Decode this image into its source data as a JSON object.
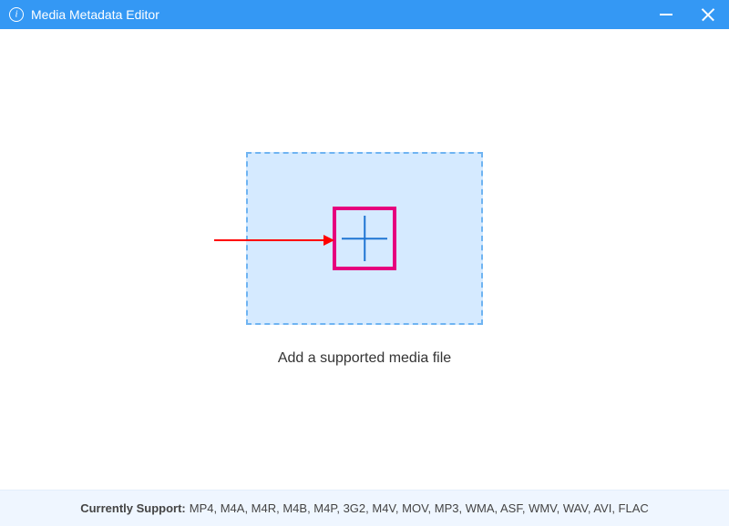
{
  "window": {
    "title": "Media Metadata Editor"
  },
  "main": {
    "caption": "Add a supported media file"
  },
  "footer": {
    "label": "Currently Support:",
    "formats": "MP4, M4A, M4R, M4B, M4P, 3G2, M4V, MOV, MP3, WMA, ASF, WMV, WAV, AVI, FLAC"
  }
}
